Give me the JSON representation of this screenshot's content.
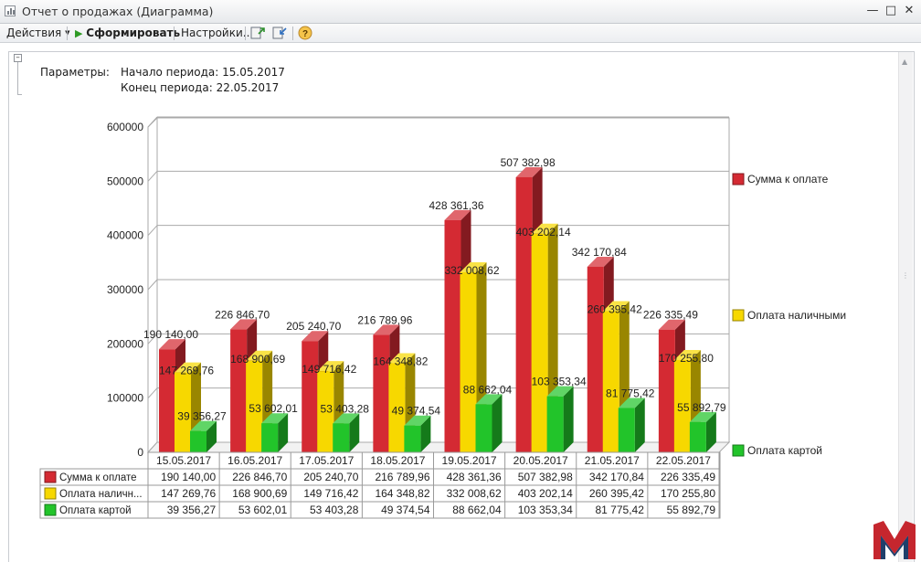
{
  "window": {
    "title": "Отчет о продажах (Диаграмма)"
  },
  "toolbar": {
    "actions_label": "Действия",
    "generate_label": "Сформировать",
    "settings_label": "Настройки..."
  },
  "params": {
    "label": "Параметры:",
    "start": "Начало периода: 15.05.2017",
    "end": "Конец периода: 22.05.2017"
  },
  "colors": {
    "red": "#d42a33",
    "yellow": "#f7d800",
    "green": "#22c42a",
    "grid": "#a9a9a9"
  },
  "chart_data": {
    "type": "bar",
    "title": "",
    "xlabel": "",
    "ylabel": "",
    "ylim": [
      0,
      600000
    ],
    "yticks": [
      "0",
      "100000",
      "200000",
      "300000",
      "400000",
      "500000",
      "600000"
    ],
    "grid": true,
    "legend_position": "right",
    "categories": [
      "15.05.2017",
      "16.05.2017",
      "17.05.2017",
      "18.05.2017",
      "19.05.2017",
      "20.05.2017",
      "21.05.2017",
      "22.05.2017"
    ],
    "series": [
      {
        "name": "Сумма к оплате",
        "table_name": "Сумма к оплате",
        "color": "#d42a33",
        "values": [
          190140.0,
          226846.7,
          205240.7,
          216789.96,
          428361.36,
          507382.98,
          342170.84,
          226335.49
        ],
        "labels": [
          "190 140,00",
          "226 846,70",
          "205 240,70",
          "216 789,96",
          "428 361,36",
          "507 382,98",
          "342 170,84",
          "226 335,49"
        ]
      },
      {
        "name": "Оплата наличными",
        "table_name": "Оплата наличн...",
        "color": "#f7d800",
        "values": [
          147269.76,
          168900.69,
          149716.42,
          164348.82,
          332008.62,
          403202.14,
          260395.42,
          170255.8
        ],
        "labels": [
          "147 269,76",
          "168 900,69",
          "149 716,42",
          "164 348,82",
          "332 008,62",
          "403 202,14",
          "260 395,42",
          "170 255,80"
        ]
      },
      {
        "name": "Оплата картой",
        "table_name": "Оплата картой",
        "color": "#22c42a",
        "values": [
          39356.27,
          53602.01,
          53403.28,
          49374.54,
          88662.04,
          103353.34,
          81775.42,
          55892.79
        ],
        "labels": [
          "39 356,27",
          "53 602,01",
          "53 403,28",
          "49 374,54",
          "88 662,04",
          "103 353,34",
          "81 775,42",
          "55 892,79"
        ]
      }
    ]
  }
}
